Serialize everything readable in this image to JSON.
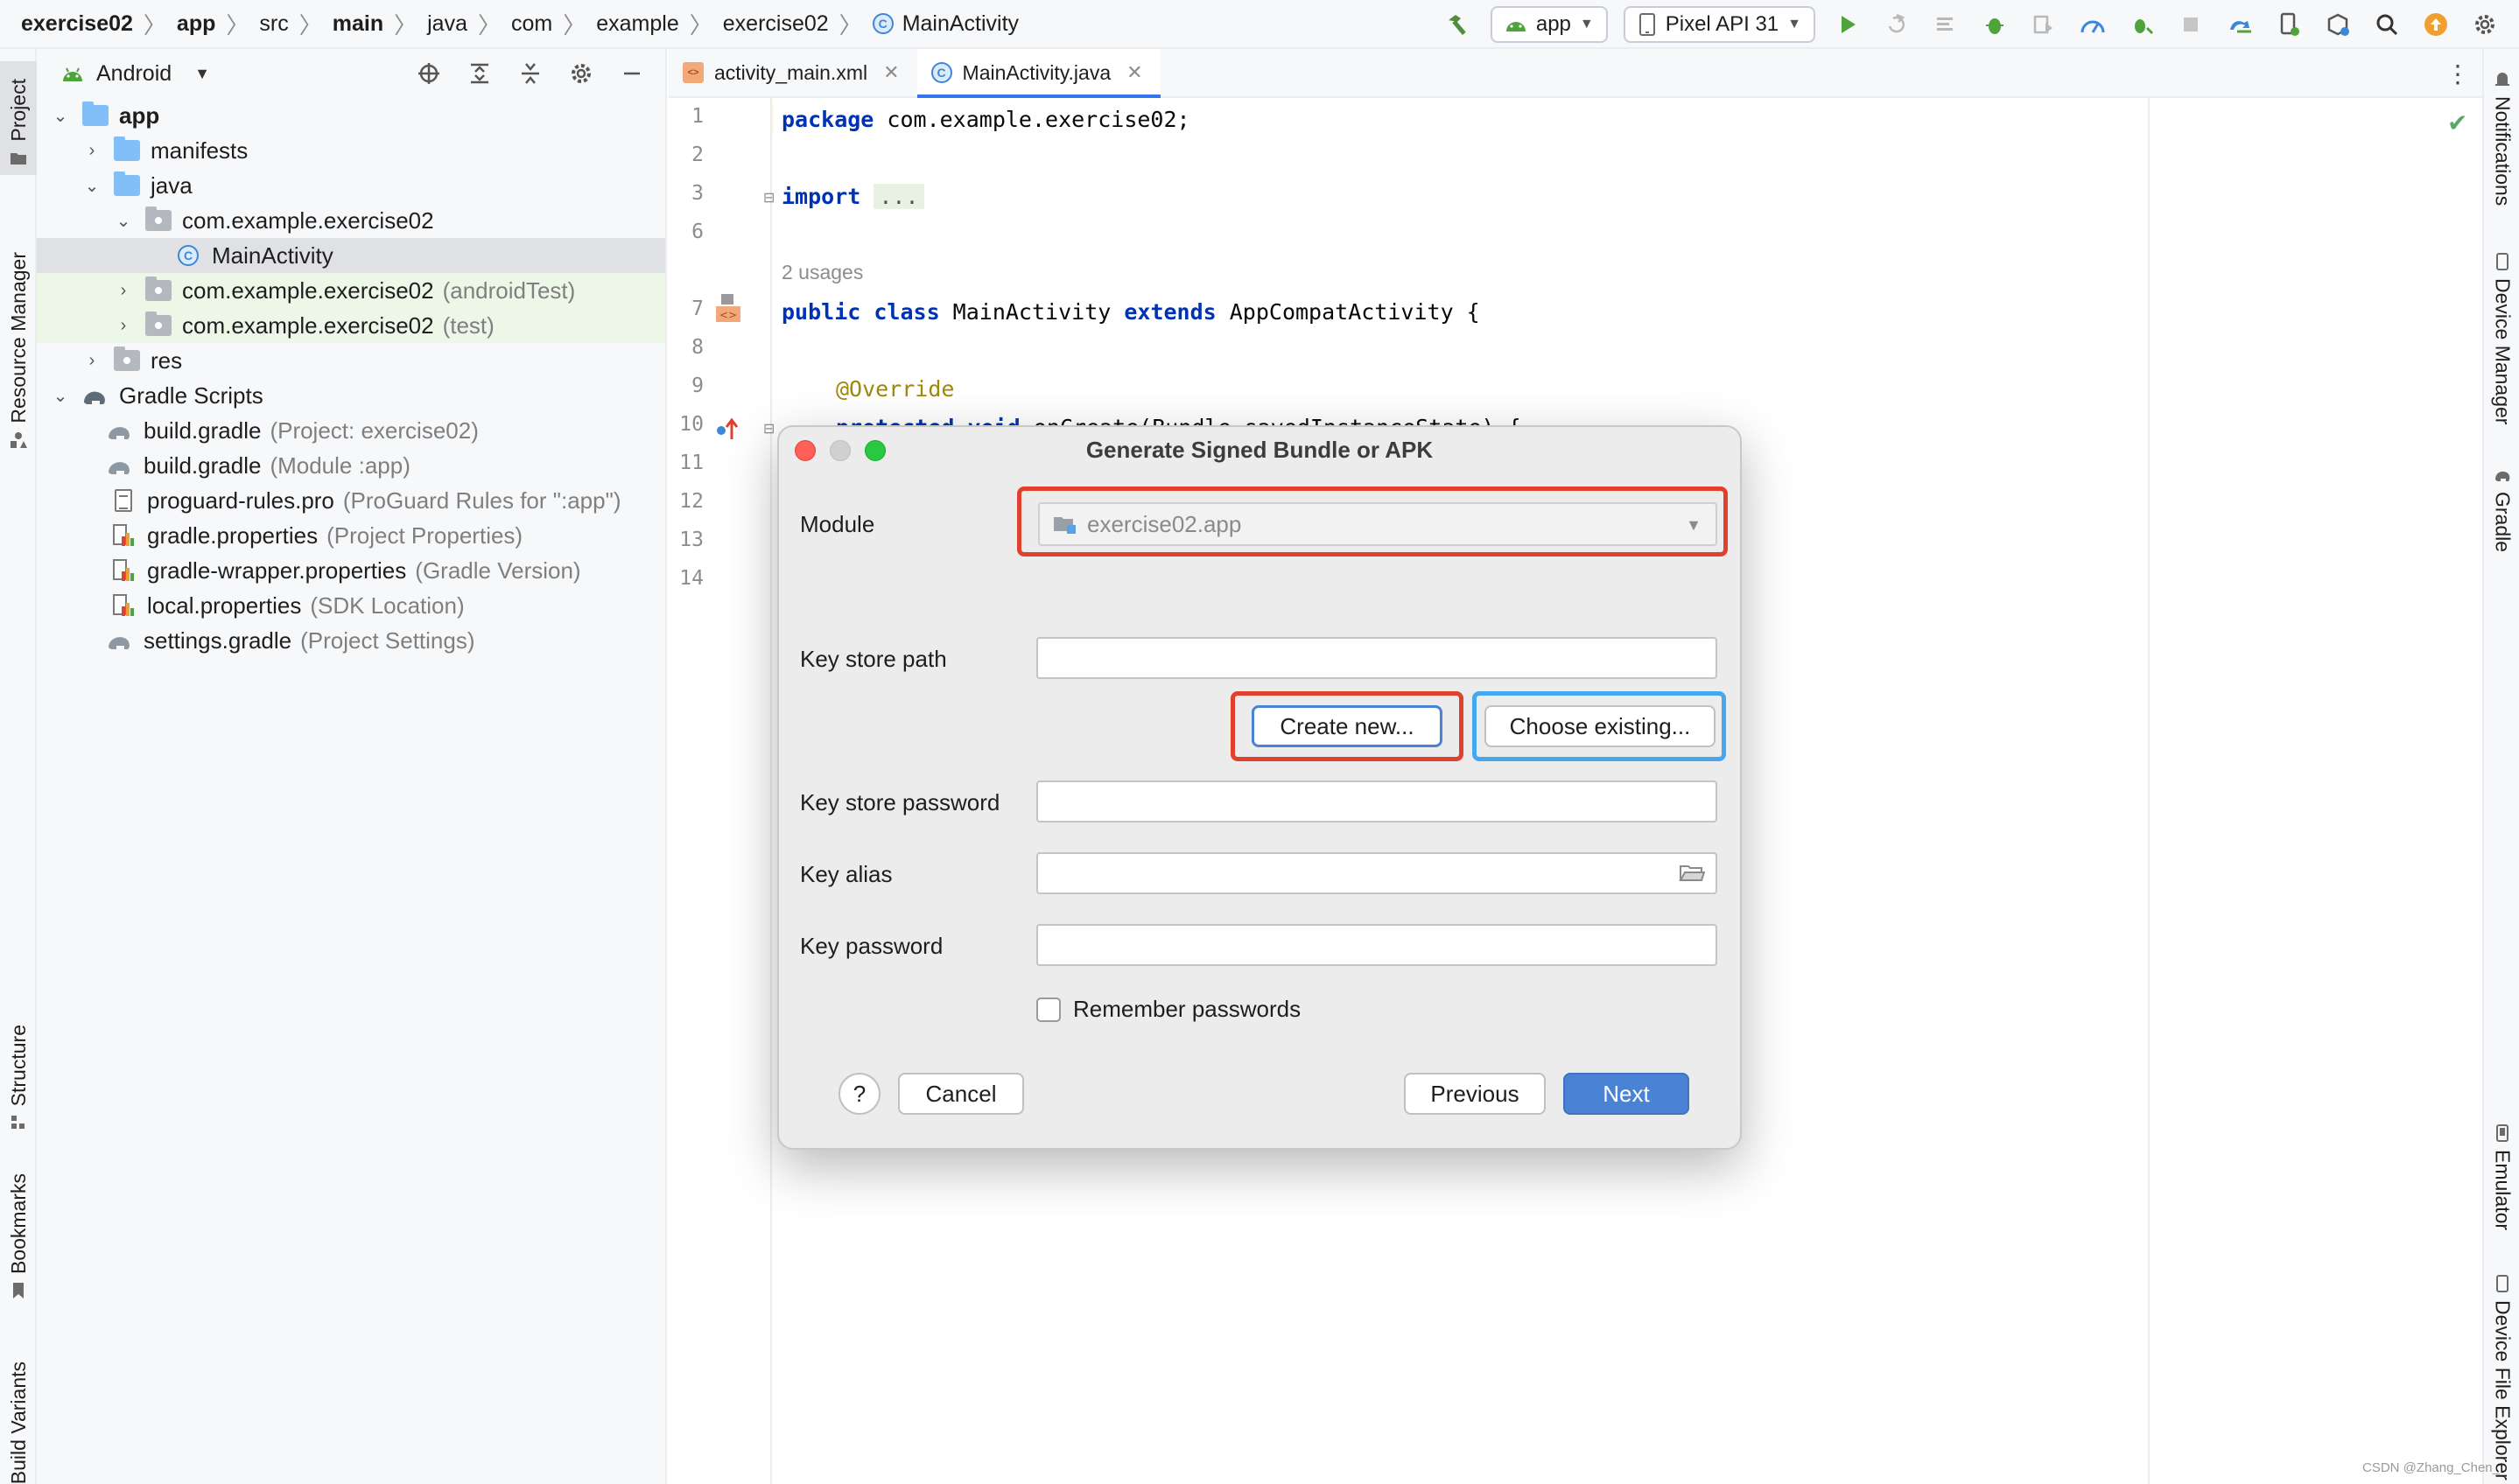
{
  "breadcrumbs": [
    "exercise02",
    "app",
    "src",
    "main",
    "java",
    "com",
    "example",
    "exercise02",
    "MainActivity"
  ],
  "toolbar": {
    "run_config": "app",
    "device": "Pixel API 31"
  },
  "left_stripe": {
    "project": "Project",
    "resource_manager": "Resource Manager",
    "structure": "Structure",
    "bookmarks": "Bookmarks",
    "build_variants": "Build Variants"
  },
  "right_stripe": {
    "notifications": "Notifications",
    "device_manager": "Device Manager",
    "gradle": "Gradle",
    "emulator": "Emulator",
    "device_file_explorer": "Device File Explorer"
  },
  "project_panel": {
    "view_mode": "Android",
    "tree": [
      {
        "label": "app",
        "hint": ""
      },
      {
        "label": "manifests",
        "hint": ""
      },
      {
        "label": "java",
        "hint": ""
      },
      {
        "label": "com.example.exercise02",
        "hint": ""
      },
      {
        "label": "MainActivity",
        "hint": ""
      },
      {
        "label": "com.example.exercise02",
        "hint": "(androidTest)"
      },
      {
        "label": "com.example.exercise02",
        "hint": "(test)"
      },
      {
        "label": "res",
        "hint": ""
      },
      {
        "label": "Gradle Scripts",
        "hint": ""
      },
      {
        "label": "build.gradle",
        "hint": "(Project: exercise02)"
      },
      {
        "label": "build.gradle",
        "hint": "(Module :app)"
      },
      {
        "label": "proguard-rules.pro",
        "hint": "(ProGuard Rules for \":app\")"
      },
      {
        "label": "gradle.properties",
        "hint": "(Project Properties)"
      },
      {
        "label": "gradle-wrapper.properties",
        "hint": "(Gradle Version)"
      },
      {
        "label": "local.properties",
        "hint": "(SDK Location)"
      },
      {
        "label": "settings.gradle",
        "hint": "(Project Settings)"
      }
    ]
  },
  "editor": {
    "tabs": [
      "activity_main.xml",
      "MainActivity.java"
    ],
    "line_numbers": [
      "1",
      "2",
      "3",
      "6",
      "7",
      "8",
      "9",
      "10",
      "11",
      "12",
      "13",
      "14"
    ],
    "code": {
      "l1_kw": "package",
      "l1_rest": " com.example.exercise02;",
      "l3_kw": "import",
      "l3_fold": "...",
      "usages": "2 usages",
      "l7_kw1": "public class",
      "l7_name": " MainActivity ",
      "l7_kw2": "extends",
      "l7_rest": " AppCompatActivity {",
      "l9_anno": "@Override",
      "l10_kw": "protected void",
      "l10_rest": " onCreate(Bundle savedInstanceState) {"
    }
  },
  "dialog": {
    "title": "Generate Signed Bundle or APK",
    "module_label": "Module",
    "module_value": "exercise02.app",
    "key_store_path_label": "Key store path",
    "create_new": "Create new...",
    "choose_existing": "Choose existing...",
    "key_store_password_label": "Key store password",
    "key_alias_label": "Key alias",
    "key_password_label": "Key password",
    "remember_passwords": "Remember passwords",
    "help": "?",
    "cancel": "Cancel",
    "previous": "Previous",
    "next": "Next"
  },
  "watermark": "CSDN @Zhang_Chen_",
  "colors": {
    "accent": "#3574f0",
    "highlight_red": "#e0412f",
    "highlight_blue": "#46a7ee",
    "next_button": "#4a83d4"
  }
}
